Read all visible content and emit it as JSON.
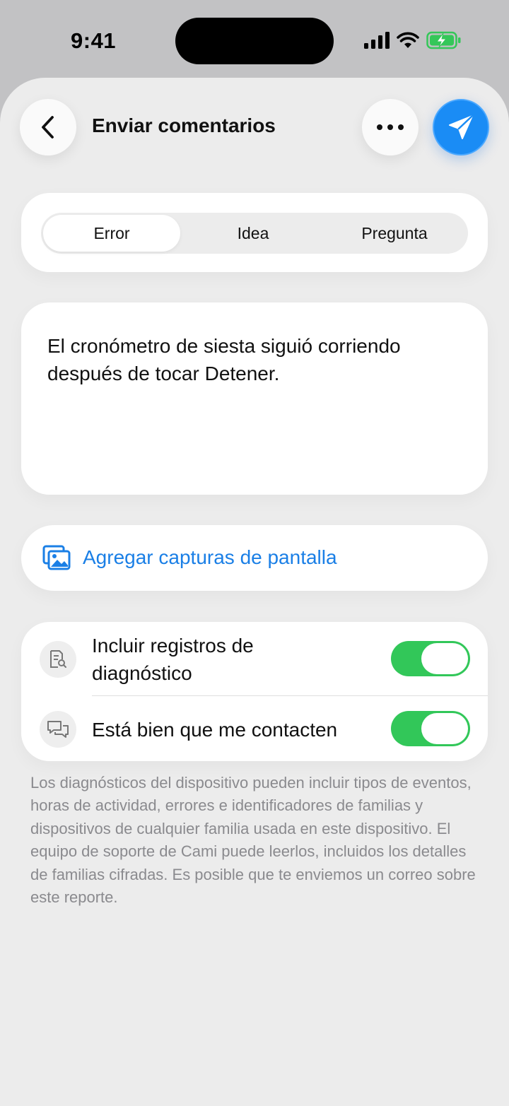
{
  "status_bar": {
    "time": "9:41",
    "icons": [
      "cellular-signal-icon",
      "wifi-icon",
      "battery-charging-icon"
    ],
    "battery_color": "#34c759"
  },
  "header": {
    "title": "Enviar comentarios",
    "icons": {
      "back": "chevron-left-icon",
      "more": "ellipsis-icon",
      "send": "paper-plane-icon"
    }
  },
  "feedback_type": {
    "options": [
      "Error",
      "Idea",
      "Pregunta"
    ],
    "selected": "Error"
  },
  "comment": {
    "value": "El cronómetro de siesta siguió corriendo después de tocar Detener."
  },
  "attachments": {
    "label": "Agregar capturas de pantalla",
    "icon": "photos-icon"
  },
  "toggles": [
    {
      "label": "Incluir registros de diagnóstico",
      "icon": "document-search-icon",
      "on": true
    },
    {
      "label": "Está bien que me contacten",
      "icon": "chat-bubbles-icon",
      "on": true
    }
  ],
  "footnote": "Los diagnósticos del dispositivo pueden incluir tipos de eventos, horas de actividad, errores e identificadores de familias y dispositivos de cualquier familia usada en este dispositivo. El equipo de soporte de Cami puede leerlos, incluidos los detalles de familias cifradas. Es posible que te enviemos un correo sobre este reporte.",
  "colors": {
    "accent": "#1a7fe6",
    "send_button": "#1a8cf5",
    "toggle_on": "#32c759"
  }
}
